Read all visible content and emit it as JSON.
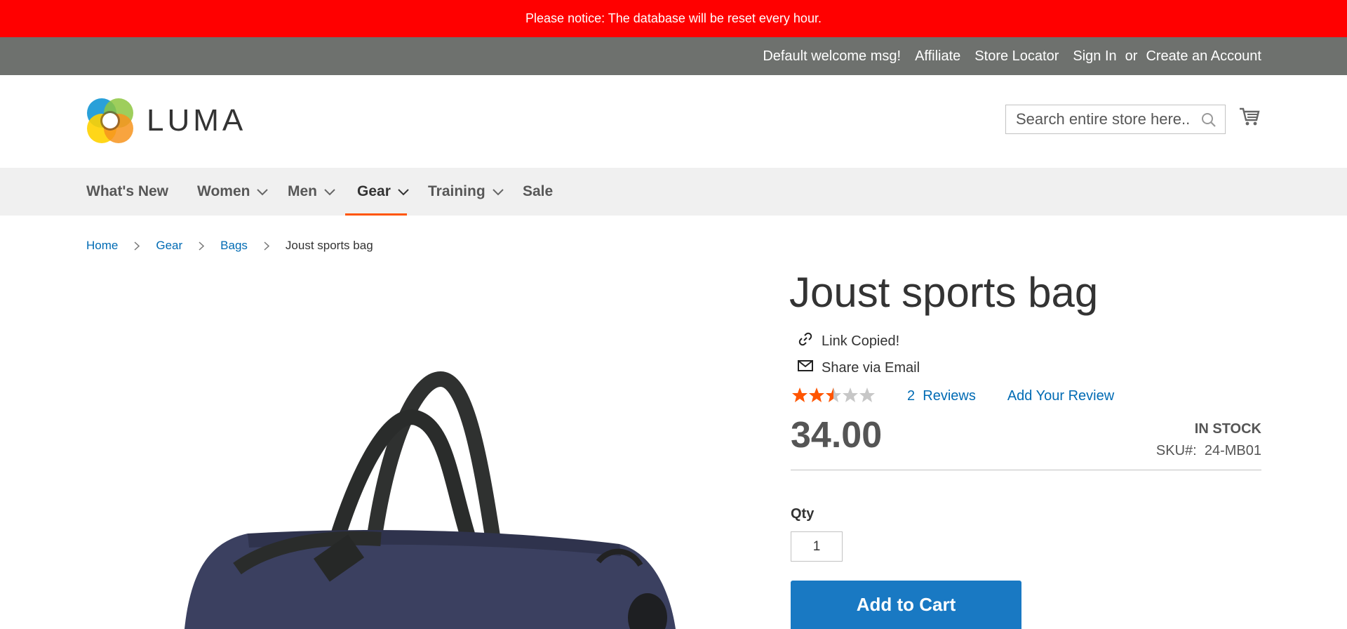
{
  "notice": {
    "text": "Please notice: The database will be reset every hour."
  },
  "topbar": {
    "welcome": "Default welcome msg!",
    "affiliate": "Affiliate",
    "store_locator": "Store Locator",
    "sign_in": "Sign In",
    "or": "or",
    "create_account": "Create an Account"
  },
  "header": {
    "logo_text": "LUMA",
    "search_placeholder": "Search entire store here...",
    "search_icon": "search-icon",
    "cart_icon": "cart-icon"
  },
  "nav": {
    "items": [
      {
        "label": "What's New",
        "has_dropdown": false
      },
      {
        "label": "Women",
        "has_dropdown": true
      },
      {
        "label": "Men",
        "has_dropdown": true
      },
      {
        "label": "Gear",
        "has_dropdown": true,
        "active": true
      },
      {
        "label": "Training",
        "has_dropdown": true
      },
      {
        "label": "Sale",
        "has_dropdown": false
      }
    ],
    "active_color": "#ff5501"
  },
  "breadcrumb": {
    "items": [
      "Home",
      "Gear",
      "Bags"
    ],
    "current": "Joust sports bag"
  },
  "product": {
    "title": "Joust sports bag",
    "link_copied": "Link Copied!",
    "share_email": "Share via Email",
    "rating_stars": 2.5,
    "rating_max": 5,
    "reviews_count": "2",
    "reviews_label": "Reviews",
    "add_review": "Add Your Review",
    "price": "34.00",
    "stock": "IN STOCK",
    "sku_label": "SKU#:",
    "sku_value": "24-MB01",
    "qty_label": "Qty",
    "qty_value": "1",
    "add_to_cart": "Add to Cart"
  },
  "colors": {
    "notice_bg": "#ff0000",
    "topbar_bg": "#6e716e",
    "link": "#006bb4",
    "primary_button": "#1979c3",
    "star": "#ff5501"
  }
}
